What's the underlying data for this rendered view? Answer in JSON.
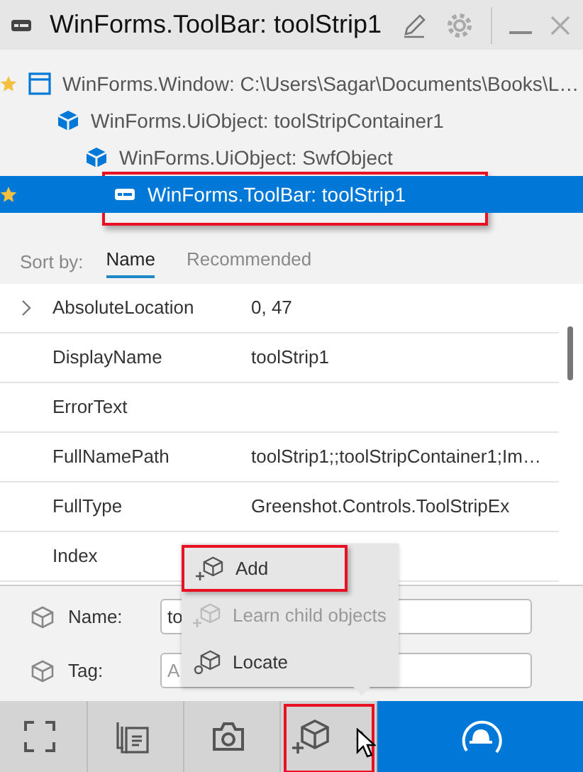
{
  "window": {
    "title": "WinForms.ToolBar: toolStrip1"
  },
  "tree": [
    {
      "label": "WinForms.Window: C:\\Users\\Sagar\\Documents\\Books\\L…",
      "kind": "window",
      "starred": true,
      "selected": false,
      "annotated": false,
      "children": [
        {
          "label": "WinForms.UiObject: toolStripContainer1",
          "kind": "object",
          "starred": false,
          "selected": false,
          "annotated": false,
          "children": [
            {
              "label": "WinForms.UiObject: SwfObject",
              "kind": "object",
              "starred": false,
              "selected": false,
              "annotated": false,
              "children": [
                {
                  "label": "WinForms.ToolBar: toolStrip1",
                  "kind": "toolbar",
                  "starred": true,
                  "selected": true,
                  "annotated": true
                }
              ]
            }
          ]
        }
      ]
    }
  ],
  "sort": {
    "label": "Sort by:",
    "tabs": [
      {
        "label": "Name",
        "selected": true
      },
      {
        "label": "Recommended",
        "selected": false
      }
    ]
  },
  "properties": [
    {
      "name": "AbsoluteLocation",
      "value": "0, 47",
      "expandable": true
    },
    {
      "name": "DisplayName",
      "value": "toolStrip1",
      "expandable": false
    },
    {
      "name": "ErrorText",
      "expandable": false
    },
    {
      "name": "FullNamePath",
      "value": "toolStrip1;;toolStripContainer1;Im…",
      "expandable": false
    },
    {
      "name": "FullType",
      "value": "Greenshot.Controls.ToolStripEx",
      "expandable": false
    },
    {
      "name": "Index",
      "expandable": false
    }
  ],
  "fields": [
    {
      "label": "Name:",
      "value": "to"
    },
    {
      "label": "Tag:",
      "placeholder": "A"
    }
  ],
  "menu": [
    {
      "label": "Add",
      "kind": "add",
      "disabled": false,
      "annotated": true
    },
    {
      "label": "Learn child objects",
      "kind": "learn",
      "disabled": true,
      "annotated": false
    },
    {
      "label": "Locate",
      "kind": "locate",
      "disabled": false,
      "annotated": false
    }
  ],
  "toolbar": [
    {
      "kind": "fullscreen",
      "selected": false,
      "annotated": false
    },
    {
      "kind": "list",
      "selected": false,
      "annotated": false
    },
    {
      "kind": "camera",
      "selected": false,
      "annotated": false
    },
    {
      "kind": "add",
      "selected": false,
      "annotated": true
    },
    {
      "kind": "spy",
      "selected": true,
      "annotated": false
    }
  ]
}
